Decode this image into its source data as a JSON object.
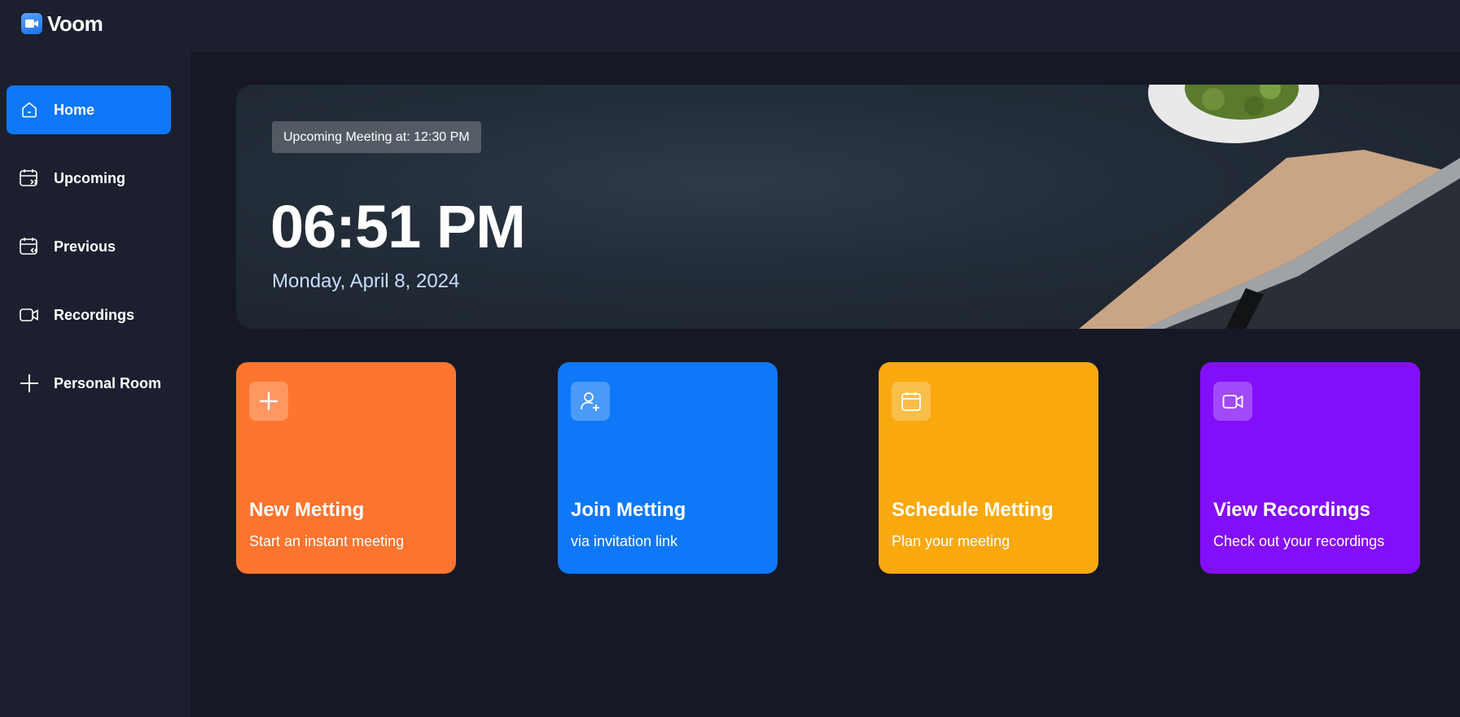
{
  "app": {
    "name": "Voom"
  },
  "sidebar": {
    "items": [
      {
        "label": "Home",
        "icon": "home-icon",
        "active": true
      },
      {
        "label": "Upcoming",
        "icon": "calendar-forward-icon",
        "active": false
      },
      {
        "label": "Previous",
        "icon": "calendar-back-icon",
        "active": false
      },
      {
        "label": "Recordings",
        "icon": "video-icon",
        "active": false
      },
      {
        "label": "Personal Room",
        "icon": "plus-icon",
        "active": false
      }
    ]
  },
  "hero": {
    "badge": "Upcoming Meeting at: 12:30 PM",
    "time": "06:51 PM",
    "date": "Monday, April 8, 2024"
  },
  "cards": [
    {
      "title": "New Metting",
      "subtitle": "Start an instant meeting",
      "icon": "plus-icon",
      "color": "#ff742e"
    },
    {
      "title": "Join Metting",
      "subtitle": "via invitation link",
      "icon": "user-add-icon",
      "color": "#0e78f9"
    },
    {
      "title": "Schedule Metting",
      "subtitle": "Plan your meeting",
      "icon": "calendar-icon",
      "color": "#f9a90e"
    },
    {
      "title": "View Recordings",
      "subtitle": "Check out your recordings",
      "icon": "video-icon",
      "color": "#830ef9"
    }
  ],
  "colors": {
    "accent": "#0e78f9",
    "background": "#161925",
    "panel": "#1c1f2e",
    "date_text": "#c9ddff"
  }
}
